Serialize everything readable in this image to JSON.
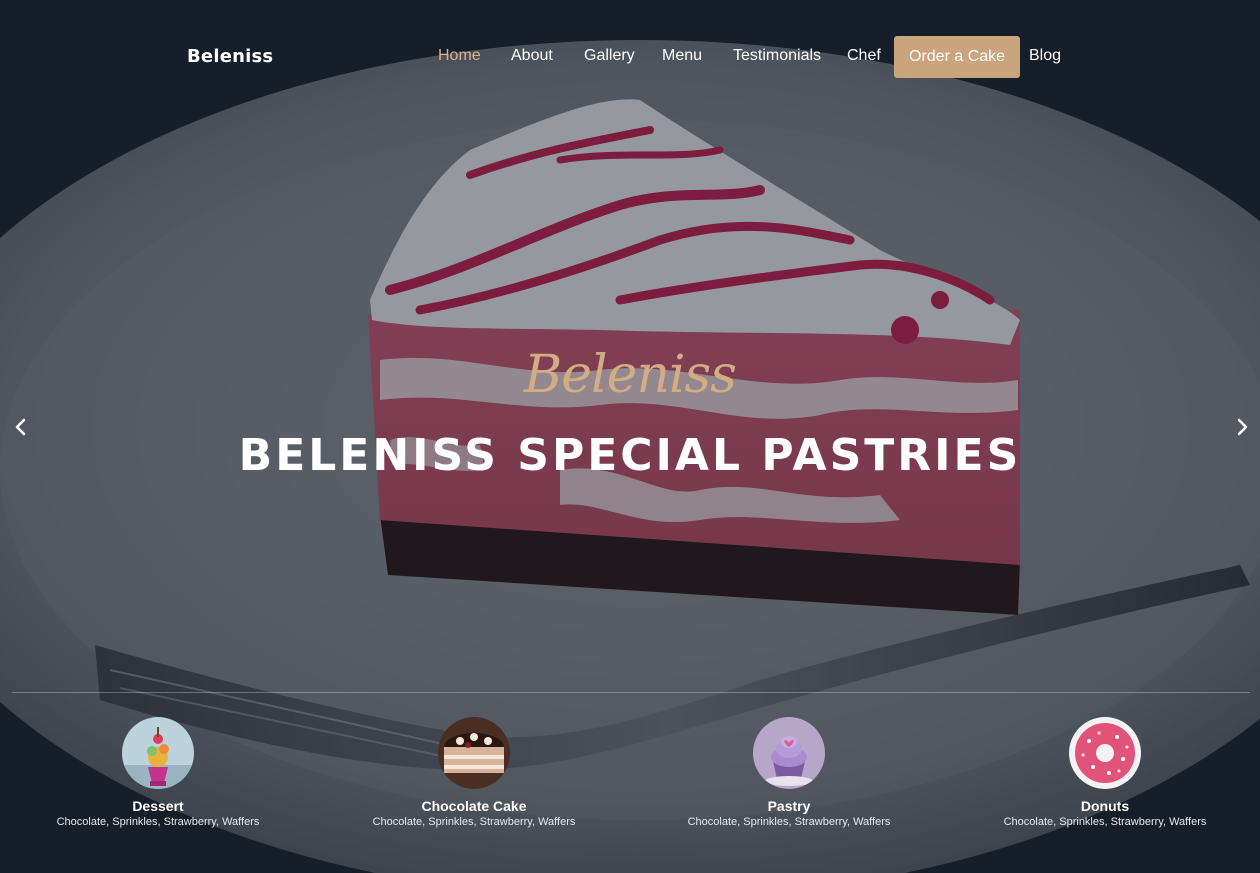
{
  "nav": {
    "brand": "Beleniss",
    "items": [
      {
        "label": "Home",
        "active": true
      },
      {
        "label": "About"
      },
      {
        "label": "Gallery"
      },
      {
        "label": "Menu"
      },
      {
        "label": "Testimonials"
      },
      {
        "label": "Chef"
      },
      {
        "label": "Order a Cake",
        "cta": true
      },
      {
        "label": "Blog"
      }
    ]
  },
  "hero": {
    "script_title": "Beleniss",
    "headline": "BELENISS SPECIAL PASTRIES",
    "prev_icon": "chevron-left-icon",
    "next_icon": "chevron-right-icon"
  },
  "categories": [
    {
      "name": "Dessert",
      "desc": "Chocolate, Sprinkles, Strawberry, Waffers"
    },
    {
      "name": "Chocolate Cake",
      "desc": "Chocolate, Sprinkles, Strawberry, Waffers"
    },
    {
      "name": "Pastry",
      "desc": "Chocolate, Sprinkles, Strawberry, Waffers"
    },
    {
      "name": "Donuts",
      "desc": "Chocolate, Sprinkles, Strawberry, Waffers"
    }
  ],
  "colors": {
    "accent": "#c9a47c",
    "active_link": "#d6b48a",
    "script_title": "#d2ad83"
  }
}
